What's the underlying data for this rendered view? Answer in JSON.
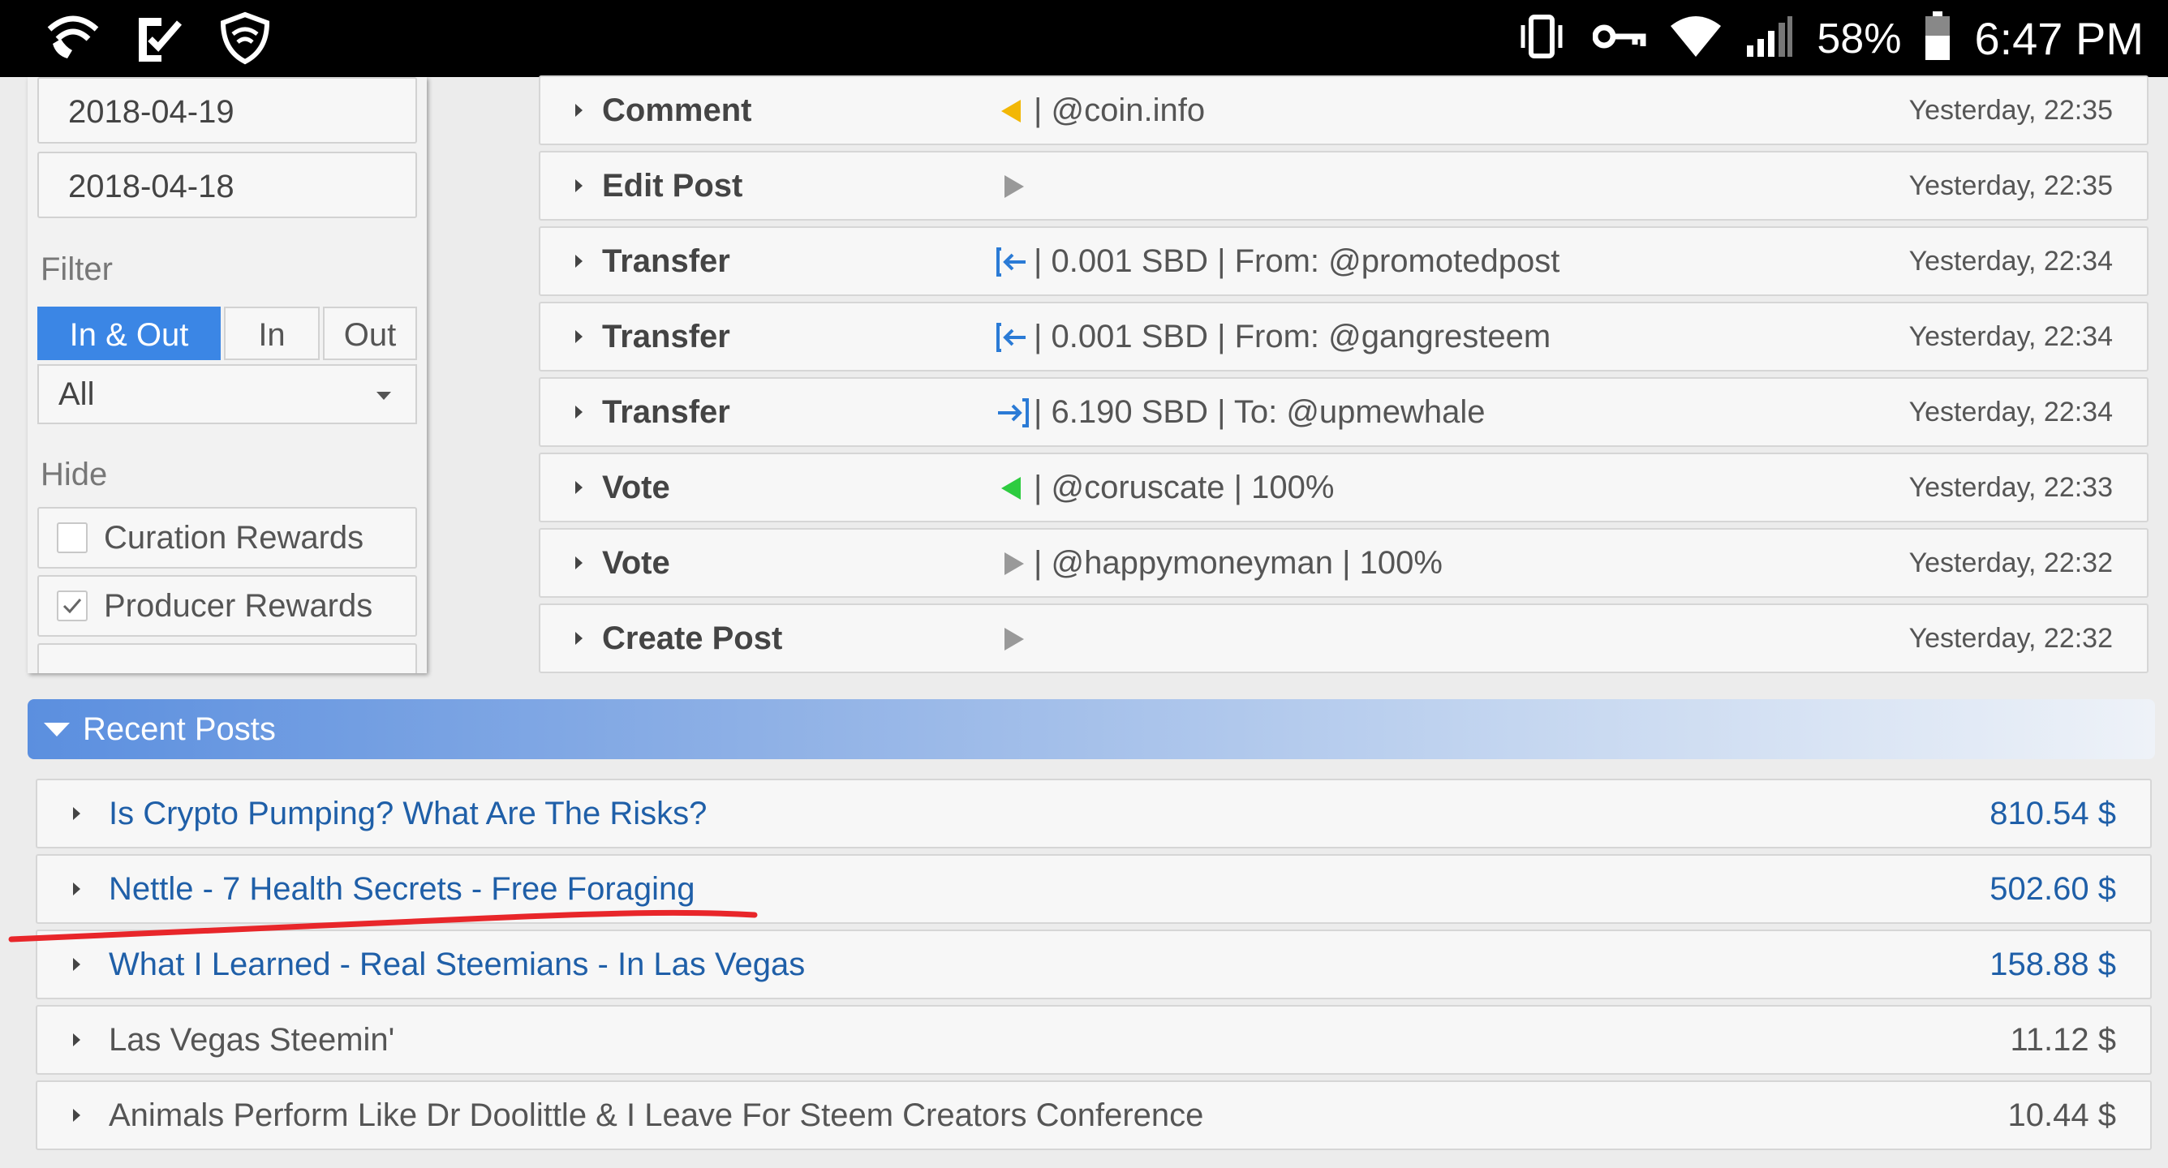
{
  "status_bar": {
    "battery_percent": "58%",
    "time": "6:47 PM",
    "icons": [
      "wifi-call-icon",
      "checklist-icon",
      "shield-wifi-icon",
      "vibrate-icon",
      "vpn-key-icon",
      "wifi-icon",
      "signal-icon",
      "battery-icon"
    ]
  },
  "sidebar": {
    "dates": [
      "2018-04-19",
      "2018-04-18"
    ],
    "filter_label": "Filter",
    "filter_buttons": [
      "In & Out",
      "In",
      "Out"
    ],
    "filter_active": "In & Out",
    "type_select_value": "All",
    "hide_label": "Hide",
    "hide_options": [
      {
        "label": "Curation Rewards",
        "checked": false
      },
      {
        "label": "Producer Rewards",
        "checked": true
      }
    ]
  },
  "operations": [
    {
      "type": "Comment",
      "icon": "arrow-left-yellow-icon",
      "detail": "| @coin.info",
      "time": "Yesterday, 22:35"
    },
    {
      "type": "Edit Post",
      "icon": "arrow-right-gray-icon",
      "detail": "",
      "time": "Yesterday, 22:35"
    },
    {
      "type": "Transfer",
      "icon": "transfer-in-icon",
      "detail": "| 0.001 SBD | From: @promotedpost",
      "time": "Yesterday, 22:34"
    },
    {
      "type": "Transfer",
      "icon": "transfer-in-icon",
      "detail": "| 0.001 SBD | From: @gangresteem",
      "time": "Yesterday, 22:34"
    },
    {
      "type": "Transfer",
      "icon": "transfer-out-icon",
      "detail": "| 6.190 SBD | To: @upmewhale",
      "time": "Yesterday, 22:34"
    },
    {
      "type": "Vote",
      "icon": "arrow-left-green-icon",
      "detail": "| @coruscate | 100%",
      "time": "Yesterday, 22:33"
    },
    {
      "type": "Vote",
      "icon": "arrow-right-gray-icon",
      "detail": "| @happymoneyman | 100%",
      "time": "Yesterday, 22:32"
    },
    {
      "type": "Create Post",
      "icon": "arrow-right-gray-icon",
      "detail": "",
      "time": "Yesterday, 22:32"
    }
  ],
  "recent_posts": {
    "title": "Recent Posts",
    "items": [
      {
        "title": "Is Crypto Pumping? What Are The Risks?",
        "amount": "810.54 $",
        "link": true
      },
      {
        "title": "Nettle - 7 Health Secrets - Free Foraging",
        "amount": "502.60 $",
        "link": true
      },
      {
        "title": "What I Learned - Real Steemians - In Las Vegas",
        "amount": "158.88 $",
        "link": true
      },
      {
        "title": "Las Vegas Steemin'",
        "amount": "11.12 $",
        "link": false
      },
      {
        "title": "Animals Perform Like Dr Doolittle & I Leave For Steem Creators Conference",
        "amount": "10.44 $",
        "link": false
      }
    ]
  },
  "colors": {
    "accent_blue": "#3b86e5",
    "link_blue": "#1f5fa8",
    "vote_green": "#2ecc40",
    "comment_yellow": "#f2b705",
    "annotation_red": "#e8262a"
  }
}
